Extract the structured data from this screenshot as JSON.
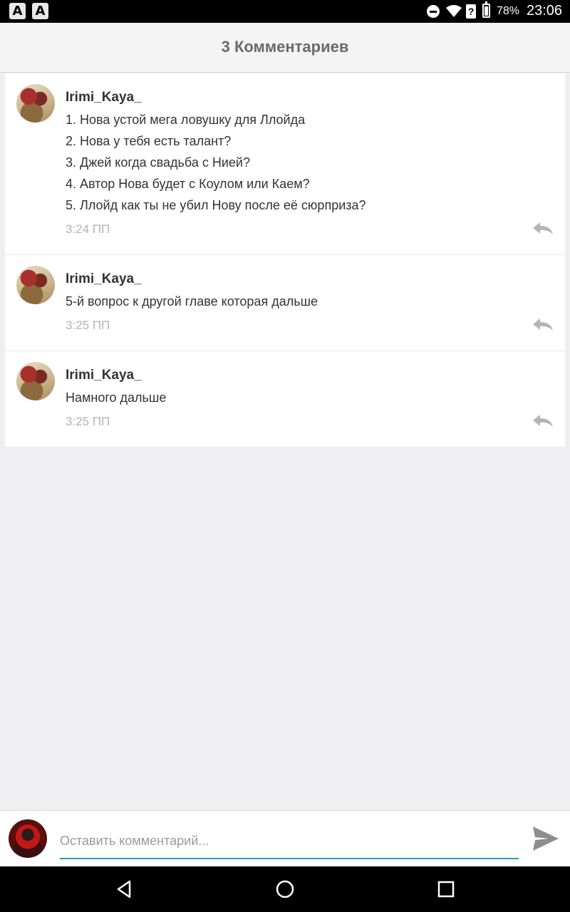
{
  "status_bar": {
    "notification_icons": [
      "app-a-icon",
      "app-a-icon"
    ],
    "status_icons": [
      "do-not-disturb-icon",
      "wifi-icon",
      "sim-unknown-icon",
      "battery-icon"
    ],
    "sim_label": "?",
    "battery_percent": "78%",
    "time": "23:06"
  },
  "header": {
    "title": "3 Комментариев"
  },
  "comments": [
    {
      "username": "Irimi_Kaya_",
      "lines": [
        "1. Нова устой мега ловушку для Ллойда",
        "2. Нова у тебя есть талант?",
        "3. Джей когда свадьба с Нией?",
        "4. Автор Нова будет с Коулом или Каем?",
        "5. Ллойд как ты не убил Нову после её сюрприза?"
      ],
      "time": "3:24 ПП"
    },
    {
      "username": "Irimi_Kaya_",
      "lines": [
        "5-й вопрос к другой главе которая дальше"
      ],
      "time": "3:25 ПП"
    },
    {
      "username": "Irimi_Kaya_",
      "lines": [
        "Намного дальше"
      ],
      "time": "3:25 ПП"
    }
  ],
  "input": {
    "placeholder": "Оставить комментарий...",
    "value": "",
    "accent_color": "#1aa2b2"
  },
  "nav_bar": {
    "buttons": [
      "back-icon",
      "home-icon",
      "recents-icon"
    ]
  },
  "colors": {
    "reply_icon": "#b5b5b5",
    "send_icon": "#8e8e8e",
    "header_text": "#6a6a6a"
  }
}
